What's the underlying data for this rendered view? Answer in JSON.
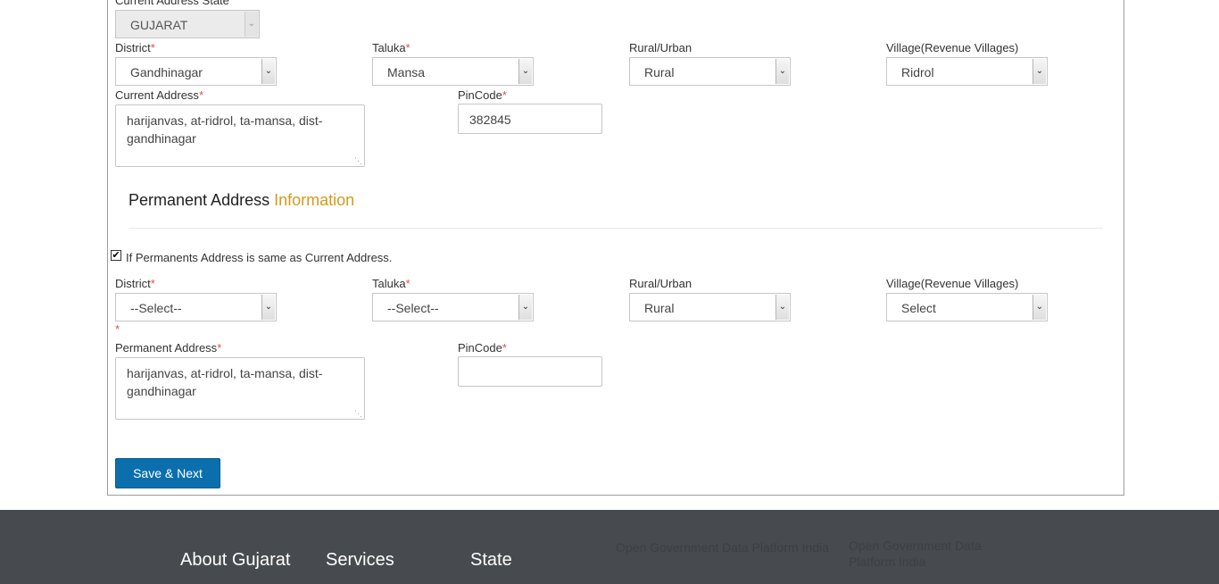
{
  "current": {
    "state_label": "Current Address State",
    "state_value": "GUJARAT",
    "district": {
      "label": "District",
      "required": "*",
      "value": "Gandhinagar"
    },
    "taluka": {
      "label": "Taluka",
      "required": "*",
      "value": "Mansa"
    },
    "rural_urban": {
      "label": "Rural/Urban",
      "value": "Rural"
    },
    "village": {
      "label": "Village(Revenue Villages)",
      "value": "Ridrol"
    },
    "address": {
      "label": "Current Address",
      "required": "*",
      "value": "harijanvas, at-ridrol, ta-mansa, dist-gandhinagar"
    },
    "pincode": {
      "label": "PinCode",
      "required": "*",
      "value": "382845"
    }
  },
  "permanent_section": {
    "title": "Permanent Address",
    "highlight": "Information"
  },
  "same_as_current": {
    "label": "If Permanents Address is same as Current Address.",
    "check": "✔"
  },
  "permanent": {
    "district": {
      "label": "District",
      "required": "*",
      "value": "--Select--"
    },
    "district_error": "*",
    "taluka": {
      "label": "Taluka",
      "required": "*",
      "value": "--Select--"
    },
    "rural_urban": {
      "label": "Rural/Urban",
      "value": "Rural"
    },
    "village": {
      "label": "Village(Revenue Villages)",
      "value": "Select"
    },
    "address": {
      "label": "Permanent Address",
      "required": "*",
      "value": "harijanvas, at-ridrol, ta-mansa, dist-gandhinagar"
    },
    "pincode": {
      "label": "PinCode",
      "required": "*",
      "value": ""
    }
  },
  "actions": {
    "save_next": "Save & Next"
  },
  "footer": {
    "about": "About Gujarat",
    "services": "Services",
    "state": "State",
    "logo1_alt": "Open Government Data Platform India",
    "logo2_alt": "Open Government Data Platform India"
  },
  "colors": {
    "accent_text": "#d49a1d",
    "primary_button": "#0b6fae",
    "required": "#d9534f",
    "footer_bg": "#474a4f"
  },
  "icons": {
    "select_arrow": "chevron-down-icon",
    "resize_grip": "resize-grip-icon",
    "checkbox": "check-icon"
  }
}
